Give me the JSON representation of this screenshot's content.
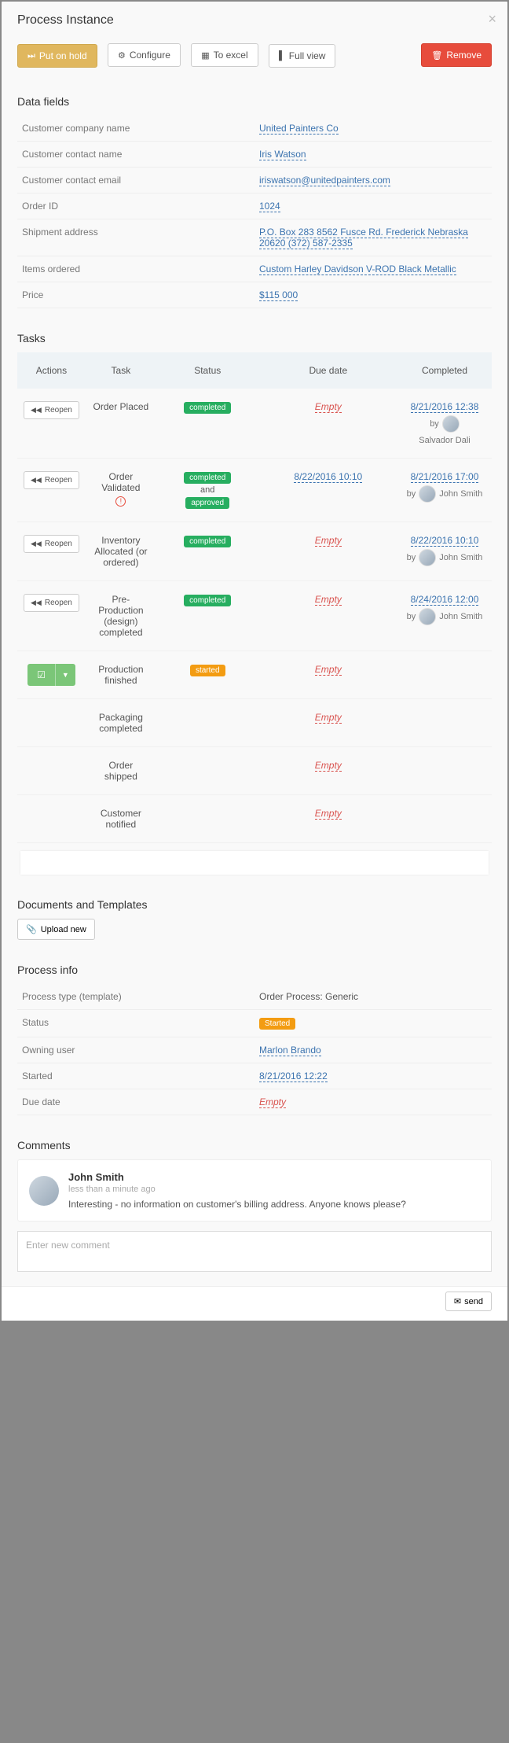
{
  "header": {
    "title": "Process Instance"
  },
  "toolbar": {
    "hold": "Put on hold",
    "configure": "Configure",
    "excel": "To excel",
    "fullview": "Full view",
    "remove": "Remove"
  },
  "datafields": {
    "heading": "Data fields",
    "rows": [
      {
        "label": "Customer company name",
        "value": "United Painters Co",
        "type": "link"
      },
      {
        "label": "Customer contact name",
        "value": "Iris Watson",
        "type": "link"
      },
      {
        "label": "Customer contact email",
        "value": "iriswatson@unitedpainters.com",
        "type": "link"
      },
      {
        "label": "Order ID",
        "value": "1024",
        "type": "link"
      },
      {
        "label": "Shipment address",
        "value": "P.O. Box 283 8562 Fusce Rd. Frederick Nebraska 20620 (372) 587-2335",
        "type": "link"
      },
      {
        "label": "Items ordered",
        "value": "Custom Harley Davidson V-ROD Black Metallic",
        "type": "link"
      },
      {
        "label": "Price",
        "value": "$115 000",
        "type": "link"
      }
    ]
  },
  "tasks": {
    "heading": "Tasks",
    "columns": {
      "actions": "Actions",
      "task": "Task",
      "status": "Status",
      "due": "Due date",
      "completed": "Completed"
    },
    "reopen_label": "Reopen",
    "by_label": "by",
    "and_label": "and",
    "rows": [
      {
        "action": "reopen",
        "task": "Order Placed",
        "status": [
          "completed"
        ],
        "warn": false,
        "due": "Empty",
        "completed_date": "8/21/2016 12:38",
        "completed_by": "Salvador Dali",
        "by_inline": false
      },
      {
        "action": "reopen",
        "task": "Order Validated",
        "status": [
          "completed",
          "approved"
        ],
        "warn": true,
        "due": "8/22/2016 10:10",
        "completed_date": "8/21/2016 17:00",
        "completed_by": "John Smith",
        "by_inline": true
      },
      {
        "action": "reopen",
        "task": "Inventory Allocated (or ordered)",
        "status": [
          "completed"
        ],
        "warn": false,
        "due": "Empty",
        "completed_date": "8/22/2016 10:10",
        "completed_by": "John Smith",
        "by_inline": true
      },
      {
        "action": "reopen",
        "task": "Pre-Production (design) completed",
        "status": [
          "completed"
        ],
        "warn": false,
        "due": "Empty",
        "completed_date": "8/24/2016 12:00",
        "completed_by": "John Smith",
        "by_inline": true
      },
      {
        "action": "finish",
        "task": "Production finished",
        "status": [
          "started"
        ],
        "warn": false,
        "due": "Empty",
        "completed_date": "",
        "completed_by": "",
        "by_inline": false
      },
      {
        "action": "none",
        "task": "Packaging completed",
        "status": [],
        "warn": false,
        "due": "Empty",
        "completed_date": "",
        "completed_by": "",
        "by_inline": false
      },
      {
        "action": "none",
        "task": "Order shipped",
        "status": [],
        "warn": false,
        "due": "Empty",
        "completed_date": "",
        "completed_by": "",
        "by_inline": false
      },
      {
        "action": "none",
        "task": "Customer notified",
        "status": [],
        "warn": false,
        "due": "Empty",
        "completed_date": "",
        "completed_by": "",
        "by_inline": false
      }
    ]
  },
  "documents": {
    "heading": "Documents and Templates",
    "upload": "Upload new"
  },
  "processinfo": {
    "heading": "Process info",
    "rows": [
      {
        "label": "Process type (template)",
        "value": "Order Process: Generic",
        "type": "text"
      },
      {
        "label": "Status",
        "value": "Started",
        "type": "badge-started"
      },
      {
        "label": "Owning user",
        "value": "Marlon Brando",
        "type": "link"
      },
      {
        "label": "Started",
        "value": "8/21/2016 12:22",
        "type": "link"
      },
      {
        "label": "Due date",
        "value": "Empty",
        "type": "empty"
      }
    ]
  },
  "comments": {
    "heading": "Comments",
    "items": [
      {
        "author": "John Smith",
        "time": "less than a minute ago",
        "text": "Interesting - no information on customer's billing address. Anyone knows please?"
      }
    ],
    "placeholder": "Enter new comment",
    "send": "send"
  }
}
